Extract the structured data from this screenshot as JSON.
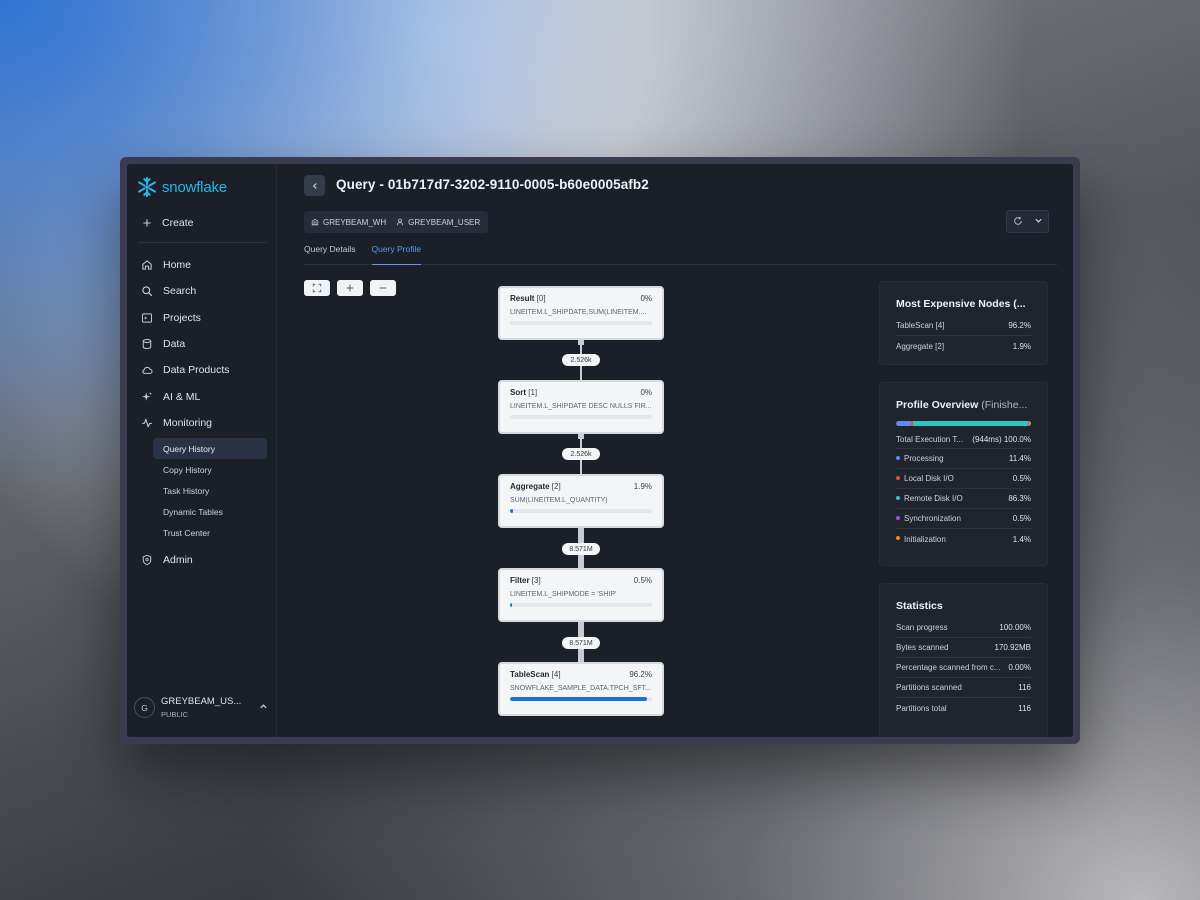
{
  "app": {
    "logo_text": "snowflake",
    "brand_color": "#29b5e8"
  },
  "sidebar": {
    "create_label": "Create",
    "items": [
      {
        "label": "Home",
        "icon": "home-icon"
      },
      {
        "label": "Search",
        "icon": "search-icon"
      },
      {
        "label": "Projects",
        "icon": "terminal-icon"
      },
      {
        "label": "Data",
        "icon": "database-icon"
      },
      {
        "label": "Data Products",
        "icon": "cloud-icon"
      },
      {
        "label": "AI & ML",
        "icon": "sparkle-icon"
      },
      {
        "label": "Monitoring",
        "icon": "activity-icon"
      }
    ],
    "monitoring_sub": [
      {
        "label": "Query History",
        "active": true
      },
      {
        "label": "Copy History",
        "active": false
      },
      {
        "label": "Task History",
        "active": false
      },
      {
        "label": "Dynamic Tables",
        "active": false
      },
      {
        "label": "Trust Center",
        "active": false
      }
    ],
    "admin_label": "Admin",
    "user": {
      "initial": "G",
      "name": "GREYBEAM_US...",
      "role": "PUBLIC"
    }
  },
  "header": {
    "title": "Query - 01b717d7-3202-9110-0005-b60e0005afb2",
    "warehouse": "GREYBEAM_WH",
    "user": "GREYBEAM_USER"
  },
  "tabs": [
    {
      "label": "Query Details",
      "active": false
    },
    {
      "label": "Query Profile",
      "active": true
    }
  ],
  "profile": {
    "nodes": [
      {
        "name": "Result",
        "index": "[0]",
        "pct": "0%",
        "detail": "LINEITEM.L_SHIPDATE,SUM(LINEITEM....",
        "fill": 0
      },
      {
        "name": "Sort",
        "index": "[1]",
        "pct": "0%",
        "detail": "LINEITEM.L_SHIPDATE DESC NULLS FIR...",
        "fill": 0
      },
      {
        "name": "Aggregate",
        "index": "[2]",
        "pct": "1.9%",
        "detail": "SUM(LINEITEM.L_QUANTITY)",
        "fill": 0.019
      },
      {
        "name": "Filter",
        "index": "[3]",
        "pct": "0.5%",
        "detail": "LINEITEM.L_SHIPMODE = 'SHIP'",
        "fill": 0.005
      },
      {
        "name": "TableScan",
        "index": "[4]",
        "pct": "96.2%",
        "detail": "SNOWFLAKE_SAMPLE_DATA.TPCH_SFT...",
        "fill": 0.962
      }
    ],
    "edges": [
      "2.526k",
      "2.526k",
      "8.571M",
      "8.571M"
    ]
  },
  "expensive": {
    "title": "Most Expensive Nodes (...",
    "rows": [
      {
        "label": "TableScan [4]",
        "value": "96.2%"
      },
      {
        "label": "Aggregate [2]",
        "value": "1.9%"
      }
    ]
  },
  "overview": {
    "title": "Profile Overview",
    "title_suffix": "(Finishe...",
    "total_label": "Total Execution T...",
    "total_value": "(944ms) 100.0%",
    "rows": [
      {
        "label": "Processing",
        "value": "11.4%",
        "color": "#5b8def",
        "share": 0.114
      },
      {
        "label": "Local Disk I/O",
        "value": "0.5%",
        "color": "#e0533d",
        "share": 0.005
      },
      {
        "label": "Remote Disk I/O",
        "value": "86.3%",
        "color": "#2ec4c4",
        "share": 0.863
      },
      {
        "label": "Synchronization",
        "value": "0.5%",
        "color": "#9b59d0",
        "share": 0.005
      },
      {
        "label": "Initialization",
        "value": "1.4%",
        "color": "#f08a24",
        "share": 0.014
      }
    ]
  },
  "statistics": {
    "title": "Statistics",
    "rows": [
      {
        "label": "Scan progress",
        "value": "100.00%"
      },
      {
        "label": "Bytes scanned",
        "value": "170.92MB"
      },
      {
        "label": "Percentage scanned from c...",
        "value": "0.00%"
      },
      {
        "label": "Partitions scanned",
        "value": "116"
      },
      {
        "label": "Partitions total",
        "value": "116"
      }
    ]
  }
}
